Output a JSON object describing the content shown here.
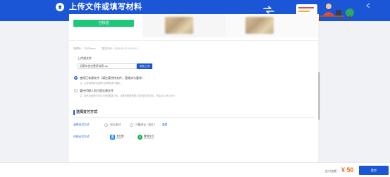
{
  "header": {
    "title": "上传文件或填写材料",
    "logo_icon": "arrow-up-circle-icon"
  },
  "preview": {
    "green_button": "已核验"
  },
  "meta": {
    "item_a": "受理号：T2020xxxx",
    "item_b": "提交时间：2020-05-20 10:41:31"
  },
  "upload": {
    "section_label": "上传源文件",
    "file_value": "标题年份交费资料表.zip",
    "upload_button": "浏览上传"
  },
  "options": [
    {
      "title": "使用已有源文件（请注意所传文件，是格式与要求）",
      "note": "注：文件和材料请选择已经材料进行确认。",
      "selected": true
    },
    {
      "title": "委托代理人员已提交源文件",
      "note": "注：若代办机构已在本人完成相关上传，请联系所属代理人员补全文件材料，电话400-000-0000",
      "selected": false
    }
  ],
  "payment": {
    "title": "选择支付方式",
    "row1_label": "选择支付方式",
    "row1_opt_a": "对公支付",
    "row1_opt_b": "只能对公（电汇）",
    "row1_link": "查看",
    "row2_label": "在线支付方式",
    "alipay_name": "支付宝",
    "alipay_sub": "ALIPAY",
    "wechat_name": "微信支付",
    "wechat_sub": "WeChat Pay"
  },
  "footer": {
    "price_label": "应付金额：",
    "price": "¥ 50",
    "submit": "提交"
  },
  "colors": {
    "brand": "#1b56d6",
    "success": "#1ec77a",
    "price": "#f26b1d"
  }
}
